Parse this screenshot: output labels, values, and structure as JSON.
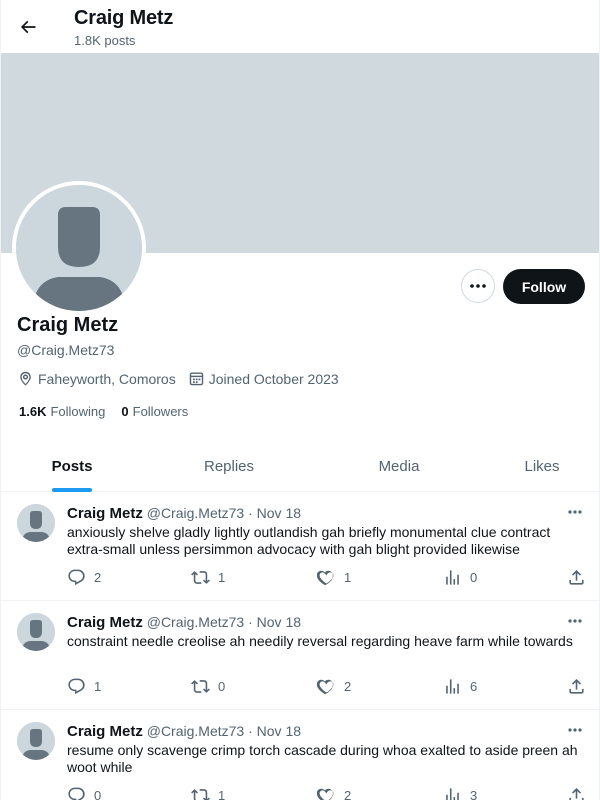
{
  "header": {
    "title": "Craig Metz",
    "post_count": "1.8K posts"
  },
  "colors": {
    "banner": "#cfd9de",
    "accent": "#1d9bf0",
    "avatar_bg": "#ccd6dd",
    "avatar_figure": "#66757f"
  },
  "profile": {
    "name": "Craig Metz",
    "handle": "@Craig.Metz73",
    "location": "Faheyworth, Comoros",
    "joined": "Joined October 2023",
    "following_count": "1.6K",
    "following_label": "Following",
    "followers_count": "0",
    "followers_label": "Followers"
  },
  "actions": {
    "more_label": "•••",
    "follow_label": "Follow"
  },
  "tabs": [
    {
      "label": "Posts",
      "active": true
    },
    {
      "label": "Replies",
      "active": false
    },
    {
      "label": "Media",
      "active": false
    },
    {
      "label": "Likes",
      "active": false
    }
  ],
  "posts": [
    {
      "name": "Craig Metz",
      "handle": "@Craig.Metz73",
      "dot": "·",
      "time": "Nov 18",
      "text": "anxiously shelve gladly lightly outlandish gah briefly monumental clue contract extra-small unless persimmon advocacy with gah blight provided likewise",
      "replies": "2",
      "reposts": "1",
      "likes": "1",
      "views": "0"
    },
    {
      "name": "Craig Metz",
      "handle": "@Craig.Metz73",
      "dot": "·",
      "time": "Nov 18",
      "text": "constraint needle creolise ah needily reversal regarding heave farm while towards",
      "replies": "1",
      "reposts": "0",
      "likes": "2",
      "views": "6"
    },
    {
      "name": "Craig Metz",
      "handle": "@Craig.Metz73",
      "dot": "·",
      "time": "Nov 18",
      "text": "resume only scavenge crimp torch cascade during whoa exalted to aside preen ah woot while",
      "replies": "0",
      "reposts": "1",
      "likes": "2",
      "views": "3"
    }
  ]
}
